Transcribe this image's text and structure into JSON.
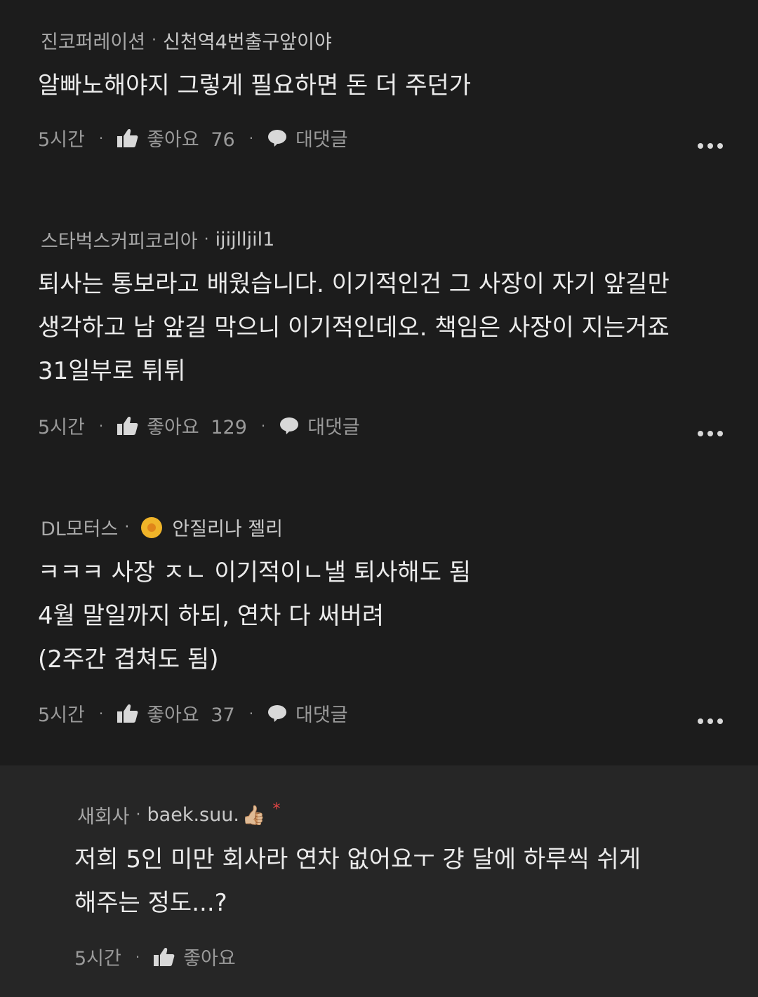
{
  "comments": [
    {
      "company": "진코퍼레이션",
      "nickname": "신천역4번출구앞이야",
      "lines": [
        "알빠노해야지 그렇게 필요하면 돈 더 주던가"
      ],
      "time": "5시간",
      "like_label": "좋아요",
      "like_count": "76",
      "reply_label": "대댓글"
    },
    {
      "company": "스타벅스커피코리아",
      "nickname": "ijijlljil1",
      "lines": [
        "퇴사는 통보라고 배웠습니다. 이기적인건 그 사장이 자기 앞길만",
        "생각하고 남 앞길 막으니 이기적인데오. 책임은 사장이 지는거죠",
        "31일부로 튀튀"
      ],
      "time": "5시간",
      "like_label": "좋아요",
      "like_count": "129",
      "reply_label": "대댓글"
    },
    {
      "company": "DL모터스",
      "nickname": "안질리나 젤리",
      "lines": [
        "ㅋㅋㅋ 사장 ㅈㄴ 이기적이ㄴ낼 퇴사해도 됨",
        "4월 말일까지 하되, 연차 다 써버려",
        "(2주간 겹쳐도 됨)"
      ],
      "time": "5시간",
      "like_label": "좋아요",
      "like_count": "37",
      "reply_label": "대댓글"
    }
  ],
  "reply": {
    "company": "새회사",
    "nickname": "baek.suu.",
    "nickname_emoji": "👍🏼",
    "author_mark": "*",
    "lines": [
      "저희 5인 미만 회사라 연차 없어요ㅜ 걍 달에 하루씩 쉬게",
      "해주는 정도...?"
    ],
    "time": "5시간",
    "like_label": "좋아요"
  },
  "meta_separator": "·",
  "action_separator": "·",
  "colors": {
    "background": "#1c1c1c",
    "reply_background": "#262626",
    "badge": "#f0b429",
    "author_mark": "#e04545"
  }
}
